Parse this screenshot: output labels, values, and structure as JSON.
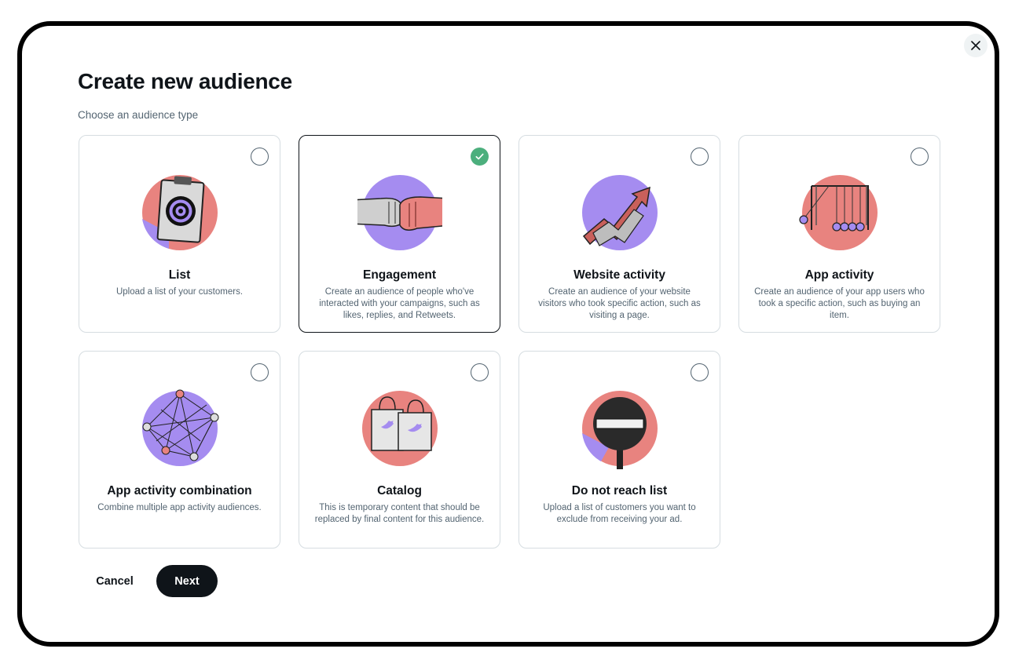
{
  "dialog": {
    "title": "Create new audience",
    "subtitle": "Choose an audience type",
    "close_icon": "close-icon"
  },
  "colors": {
    "pink": "#e8837f",
    "purple": "#a58cf0",
    "selected_check": "#4caf7d",
    "text_primary": "#0f1419",
    "text_secondary": "#536471",
    "border": "#d6dde1"
  },
  "audience_types": [
    {
      "title": "List",
      "description": "Upload a list of your customers.",
      "selected": false,
      "icon": "clipboard-target-icon"
    },
    {
      "title": "Engagement",
      "description": "Create an audience of people who've interacted with your campaigns, such as likes, replies, and Retweets.",
      "selected": true,
      "icon": "fist-bump-icon"
    },
    {
      "title": "Website activity",
      "description": "Create an audience of your website visitors who took specific action, such as visiting a page.",
      "selected": false,
      "icon": "rising-arrows-icon"
    },
    {
      "title": "App activity",
      "description": "Create an audience of your app users who took a specific action, such as buying an item.",
      "selected": false,
      "icon": "newtons-cradle-icon"
    },
    {
      "title": "App activity combination",
      "description": "Combine multiple app activity audiences.",
      "selected": false,
      "icon": "pin-network-icon"
    },
    {
      "title": "Catalog",
      "description": "This is temporary content that should be replaced by final content for this audience.",
      "selected": false,
      "icon": "shopping-bags-icon"
    },
    {
      "title": "Do not reach list",
      "description": "Upload a list of customers you want to exclude from receiving your ad.",
      "selected": false,
      "icon": "no-entry-sign-icon"
    }
  ],
  "footer": {
    "cancel_label": "Cancel",
    "next_label": "Next"
  }
}
